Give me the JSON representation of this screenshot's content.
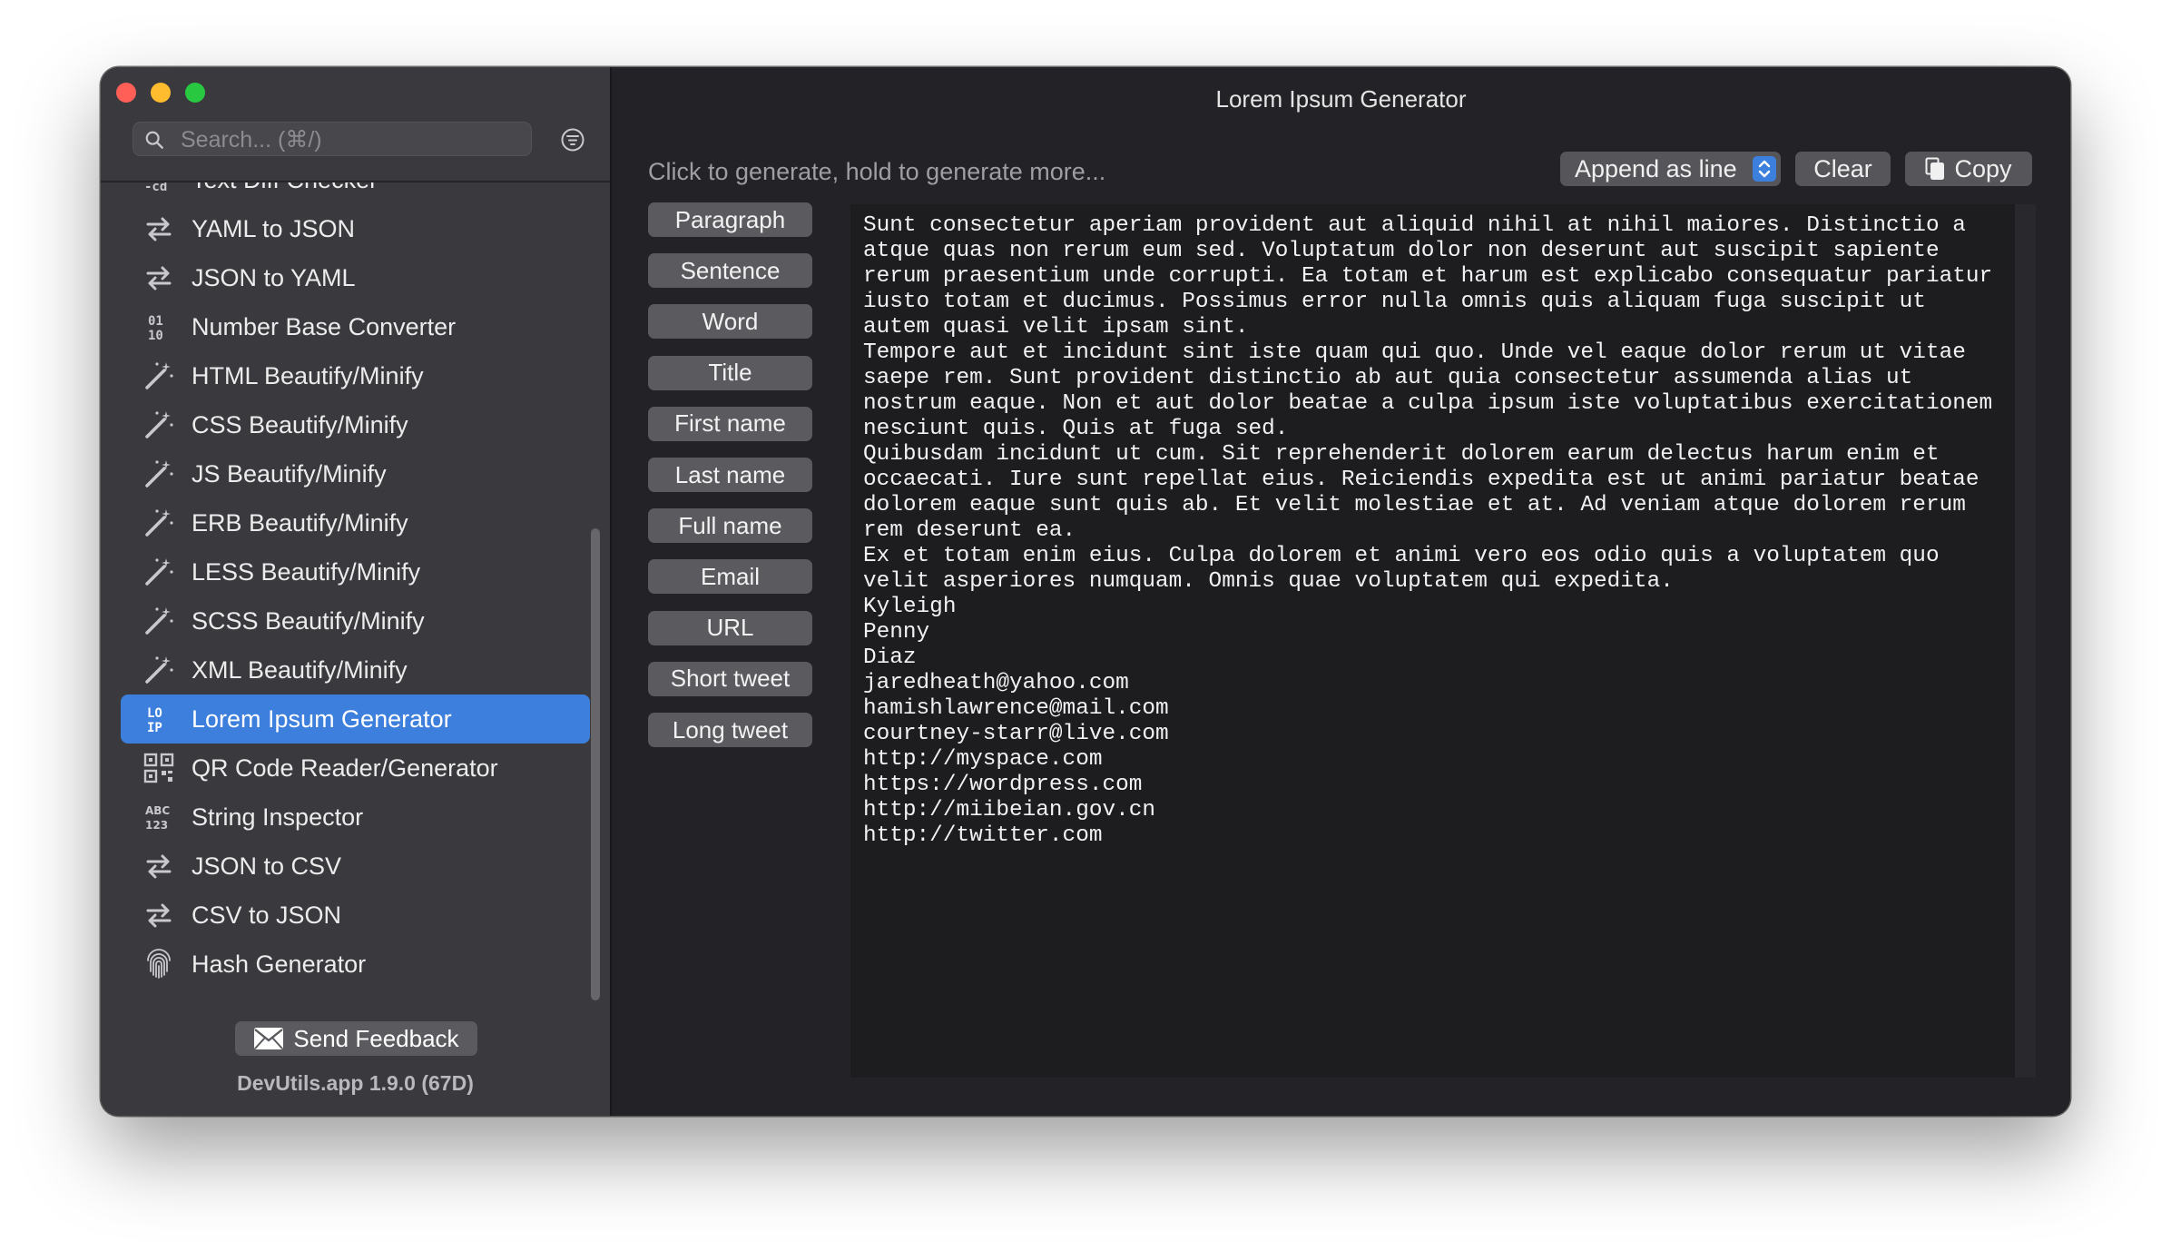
{
  "window": {
    "title": "Lorem Ipsum Generator"
  },
  "sidebar": {
    "search_placeholder": "Search... (⌘/)",
    "items": [
      {
        "label": "Text Diff Checker",
        "icon": "diff-icon",
        "name": "sidebar-item-text-diff-checker"
      },
      {
        "label": "YAML to JSON",
        "icon": "convert-arrows-icon",
        "name": "sidebar-item-yaml-to-json"
      },
      {
        "label": "JSON to YAML",
        "icon": "convert-arrows-icon",
        "name": "sidebar-item-json-to-yaml"
      },
      {
        "label": "Number Base Converter",
        "icon": "binary-icon",
        "name": "sidebar-item-number-base-converter"
      },
      {
        "label": "HTML Beautify/Minify",
        "icon": "magic-wand-icon",
        "name": "sidebar-item-html-beautify"
      },
      {
        "label": "CSS Beautify/Minify",
        "icon": "magic-wand-icon",
        "name": "sidebar-item-css-beautify"
      },
      {
        "label": "JS Beautify/Minify",
        "icon": "magic-wand-icon",
        "name": "sidebar-item-js-beautify"
      },
      {
        "label": "ERB Beautify/Minify",
        "icon": "magic-wand-icon",
        "name": "sidebar-item-erb-beautify"
      },
      {
        "label": "LESS Beautify/Minify",
        "icon": "magic-wand-icon",
        "name": "sidebar-item-less-beautify"
      },
      {
        "label": "SCSS Beautify/Minify",
        "icon": "magic-wand-icon",
        "name": "sidebar-item-scss-beautify"
      },
      {
        "label": "XML Beautify/Minify",
        "icon": "magic-wand-icon",
        "name": "sidebar-item-xml-beautify"
      },
      {
        "label": "Lorem Ipsum Generator",
        "icon": "lorem-ipsum-icon",
        "name": "sidebar-item-lorem-ipsum",
        "selected": true
      },
      {
        "label": "QR Code Reader/Generator",
        "icon": "qr-code-icon",
        "name": "sidebar-item-qr-code"
      },
      {
        "label": "String Inspector",
        "icon": "abc-123-icon",
        "name": "sidebar-item-string-inspector"
      },
      {
        "label": "JSON to CSV",
        "icon": "convert-arrows-icon",
        "name": "sidebar-item-json-to-csv"
      },
      {
        "label": "CSV to JSON",
        "icon": "convert-arrows-icon",
        "name": "sidebar-item-csv-to-json"
      },
      {
        "label": "Hash Generator",
        "icon": "fingerprint-icon",
        "name": "sidebar-item-hash-generator"
      }
    ],
    "feedback_label": "Send Feedback",
    "version": "DevUtils.app 1.9.0 (67D)"
  },
  "toolbar": {
    "hint": "Click to generate, hold to generate more...",
    "append_mode": "Append as line",
    "clear_label": "Clear",
    "copy_label": "Copy"
  },
  "generate_buttons": [
    "Paragraph",
    "Sentence",
    "Word",
    "Title",
    "First name",
    "Last name",
    "Full name",
    "Email",
    "URL",
    "Short tweet",
    "Long tweet"
  ],
  "output": {
    "lines": [
      "Sunt consectetur aperiam provident aut aliquid nihil at nihil maiores. Distinctio a",
      "atque quas non rerum eum sed. Voluptatum dolor non deserunt aut suscipit sapiente",
      "rerum praesentium unde corrupti. Ea totam et harum est explicabo consequatur pariatur",
      "iusto totam et ducimus. Possimus error nulla omnis quis aliquam fuga suscipit ut",
      "autem quasi velit ipsam sint.",
      "Tempore aut et incidunt sint iste quam qui quo. Unde vel eaque dolor rerum ut vitae",
      "saepe rem. Sunt provident distinctio ab aut quia consectetur assumenda alias ut",
      "nostrum eaque. Non et aut dolor beatae a culpa ipsum iste voluptatibus exercitationem",
      "nesciunt quis. Quis at fuga sed.",
      "Quibusdam incidunt ut cum. Sit reprehenderit dolorem earum delectus harum enim et",
      "occaecati. Iure sunt repellat eius. Reiciendis expedita est ut animi pariatur beatae",
      "dolorem eaque sunt quis ab. Et velit molestiae et at. Ad veniam atque dolorem rerum",
      "rem deserunt ea.",
      "Ex et totam enim eius. Culpa dolorem et animi vero eos odio quis a voluptatem quo",
      "velit asperiores numquam. Omnis quae voluptatem qui expedita.",
      "Kyleigh",
      "Penny",
      "Diaz",
      "jaredheath@yahoo.com",
      "hamishlawrence@mail.com",
      "courtney-starr@live.com",
      "http://myspace.com",
      "https://wordpress.com",
      "http://miibeian.gov.cn",
      "http://twitter.com"
    ]
  },
  "colors": {
    "accent": "#3d7fdc",
    "close": "#ff5f57",
    "minimize": "#febc2e",
    "maximize": "#28c840"
  }
}
